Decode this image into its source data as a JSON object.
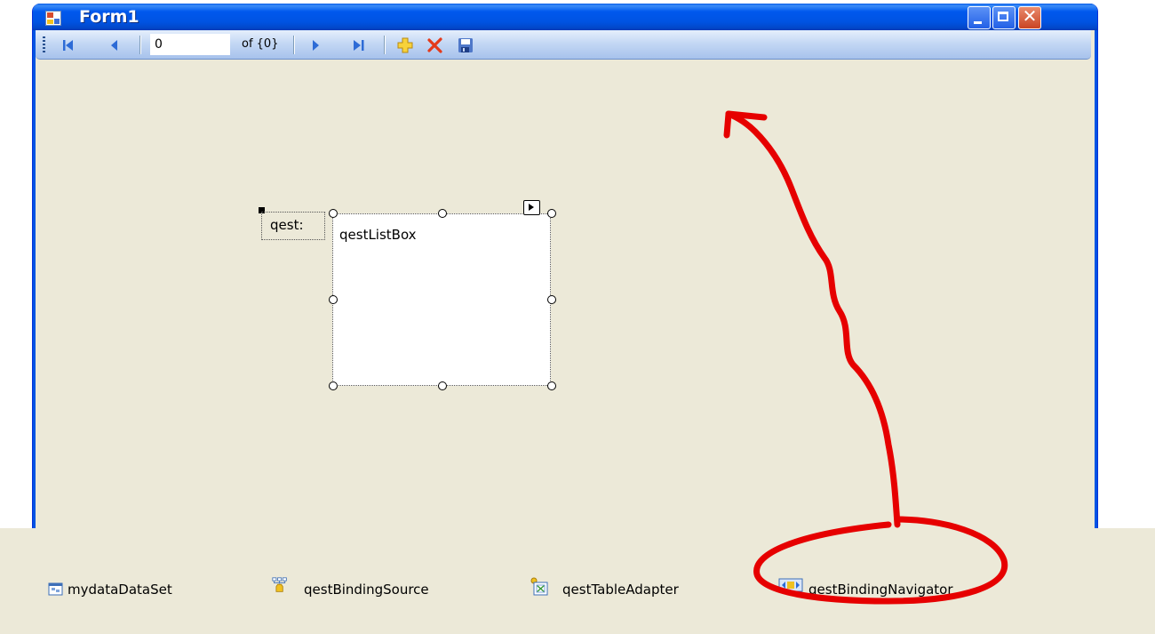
{
  "window": {
    "title": "Form1"
  },
  "navigator": {
    "position_value": "0",
    "count_label": "of {0}",
    "buttons": [
      "move-first",
      "move-previous",
      "move-next",
      "move-last",
      "add-new",
      "delete",
      "save"
    ]
  },
  "form": {
    "label_text": "qest:",
    "listbox_name": "qestListBox"
  },
  "tray": {
    "items": [
      {
        "label": "mydataDataSet",
        "icon": "dataset-icon"
      },
      {
        "label": "qestBindingSource",
        "icon": "binding-source-icon"
      },
      {
        "label": "qestTableAdapter",
        "icon": "table-adapter-icon"
      },
      {
        "label": "qestBindingNavigator",
        "icon": "binding-navigator-icon"
      }
    ]
  },
  "colors": {
    "titlebar": "#0053e1",
    "form_background": "#ece9d8",
    "annotation": "#e60000"
  }
}
